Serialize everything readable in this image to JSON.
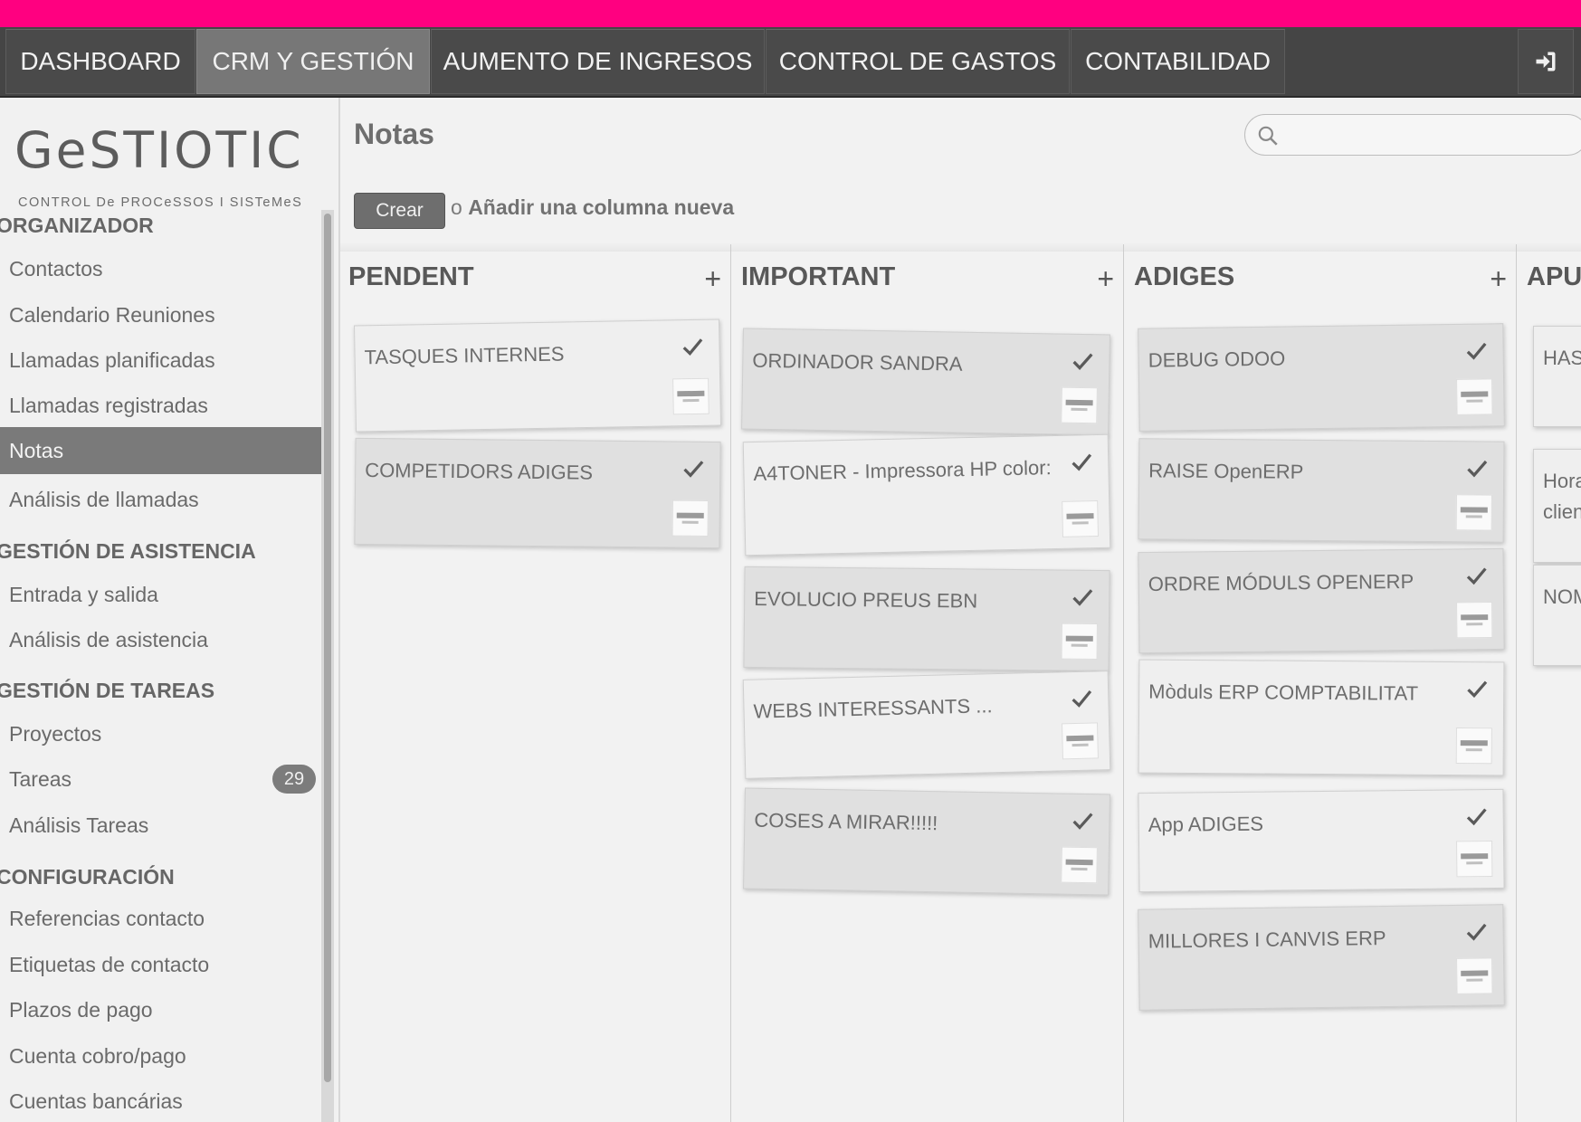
{
  "topnav": {
    "items": [
      {
        "label": "DASHBOARD"
      },
      {
        "label": "CRM Y GESTIÓN"
      },
      {
        "label": "AUMENTO DE INGRESOS"
      },
      {
        "label": "CONTROL DE GASTOS"
      },
      {
        "label": "CONTABILIDAD"
      }
    ],
    "active": "CRM Y GESTIÓN",
    "accent_color": "#ff0080"
  },
  "logo": {
    "main": "GeSTIOTIC",
    "tagline": "CONTROL De PROCeSSOS I SISTeMeS"
  },
  "sidebar": {
    "sections": [
      {
        "title": "ORGANIZADOR",
        "items": [
          {
            "label": "Contactos"
          },
          {
            "label": "Calendario Reuniones"
          },
          {
            "label": "Llamadas planificadas"
          },
          {
            "label": "Llamadas registradas"
          },
          {
            "label": "Notas"
          },
          {
            "label": "Análisis de llamadas"
          }
        ]
      },
      {
        "title": "GESTIÓN DE ASISTENCIA",
        "items": [
          {
            "label": "Entrada y salida"
          },
          {
            "label": "Análisis de asistencia"
          }
        ]
      },
      {
        "title": "GESTIÓN DE TAREAS",
        "items": [
          {
            "label": "Proyectos"
          },
          {
            "label": "Tareas",
            "badge": "29"
          },
          {
            "label": "Análisis Tareas"
          }
        ]
      },
      {
        "title": "CONFIGURACIÓN",
        "items": [
          {
            "label": "Referencias contacto"
          },
          {
            "label": "Etiquetas de contacto"
          },
          {
            "label": "Plazos de pago"
          },
          {
            "label": "Cuenta cobro/pago"
          },
          {
            "label": "Cuentas bancárias"
          }
        ]
      }
    ],
    "active_item": "Notas"
  },
  "page": {
    "title": "Notas",
    "create_label": "Crear",
    "add_column_prefix": "o",
    "add_column_label": "Añadir una columna nueva",
    "search_value": ""
  },
  "columns": [
    {
      "title": "PENDENT",
      "add": "+",
      "notes": [
        {
          "title": "TASQUES INTERNES"
        },
        {
          "title": "COMPETIDORS ADIGES"
        }
      ]
    },
    {
      "title": "IMPORTANT",
      "add": "+",
      "notes": [
        {
          "title": "ORDINADOR SANDRA"
        },
        {
          "title": "A4TONER - Impressora HP color:"
        },
        {
          "title": "EVOLUCIO PREUS EBN"
        },
        {
          "title": "WEBS INTERESSANTS ..."
        },
        {
          "title": "COSES A MIRAR!!!!!"
        }
      ]
    },
    {
      "title": "ADIGES",
      "add": "+",
      "notes": [
        {
          "title": "DEBUG ODOO"
        },
        {
          "title": "RAISE OpenERP"
        },
        {
          "title": "ORDRE MÓDULS OPENERP"
        },
        {
          "title": "Mòduls ERP COMPTABILITAT"
        },
        {
          "title": "App ADIGES"
        },
        {
          "title": "MILLORES I CANVIS ERP"
        }
      ]
    },
    {
      "title": "APU",
      "add": "",
      "notes": [
        {
          "title": "HAS"
        },
        {
          "title": "Hora clien"
        },
        {
          "title": "NOM"
        }
      ]
    }
  ]
}
